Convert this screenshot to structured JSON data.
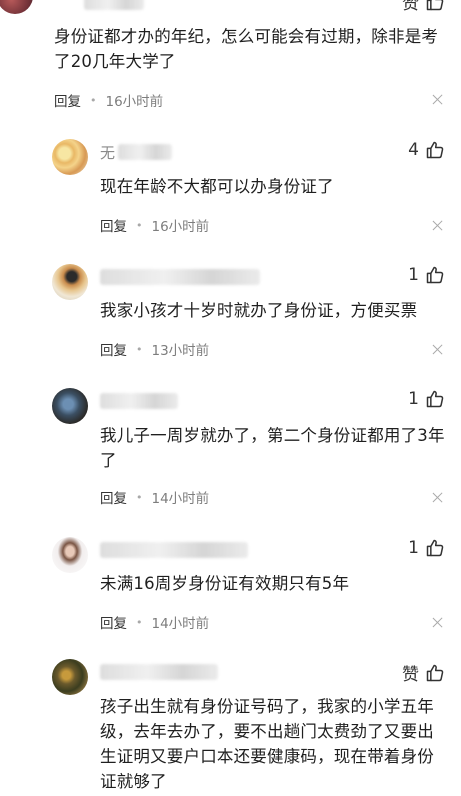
{
  "comments": [
    {
      "username": "",
      "like_label": "赞",
      "text": "身份证都才办的年纪，怎么可能会有过期，除非是考了20几年大学了",
      "reply_label": "回复",
      "time": "16小时前"
    },
    {
      "username": "无",
      "like_label": "4",
      "text": "现在年龄不大都可以办身份证了",
      "reply_label": "回复",
      "time": "16小时前"
    },
    {
      "username": "",
      "like_label": "1",
      "text": "我家小孩才十岁时就办了身份证，方便买票",
      "reply_label": "回复",
      "time": "13小时前"
    },
    {
      "username": "",
      "like_label": "1",
      "text": "我儿子一周岁就办了，第二个身份证都用了3年了",
      "reply_label": "回复",
      "time": "14小时前"
    },
    {
      "username": "",
      "like_label": "1",
      "text": "未满16周岁身份证有效期只有5年",
      "reply_label": "回复",
      "time": "14小时前"
    },
    {
      "username": "",
      "like_label": "赞",
      "text": "孩子出生就有身份证号码了，我家的小学五年级，去年去办了，要不出趟门太费劲了又要出生证明又要户口本还要健康码，现在带着身份证就够了",
      "reply_label": "",
      "time": ""
    }
  ],
  "colors": {
    "text": "#1f1f1f",
    "meta": "#7d7d7d",
    "icon": "#333333"
  },
  "icons": {
    "like": "thumbs-up-icon",
    "close": "close-icon"
  }
}
